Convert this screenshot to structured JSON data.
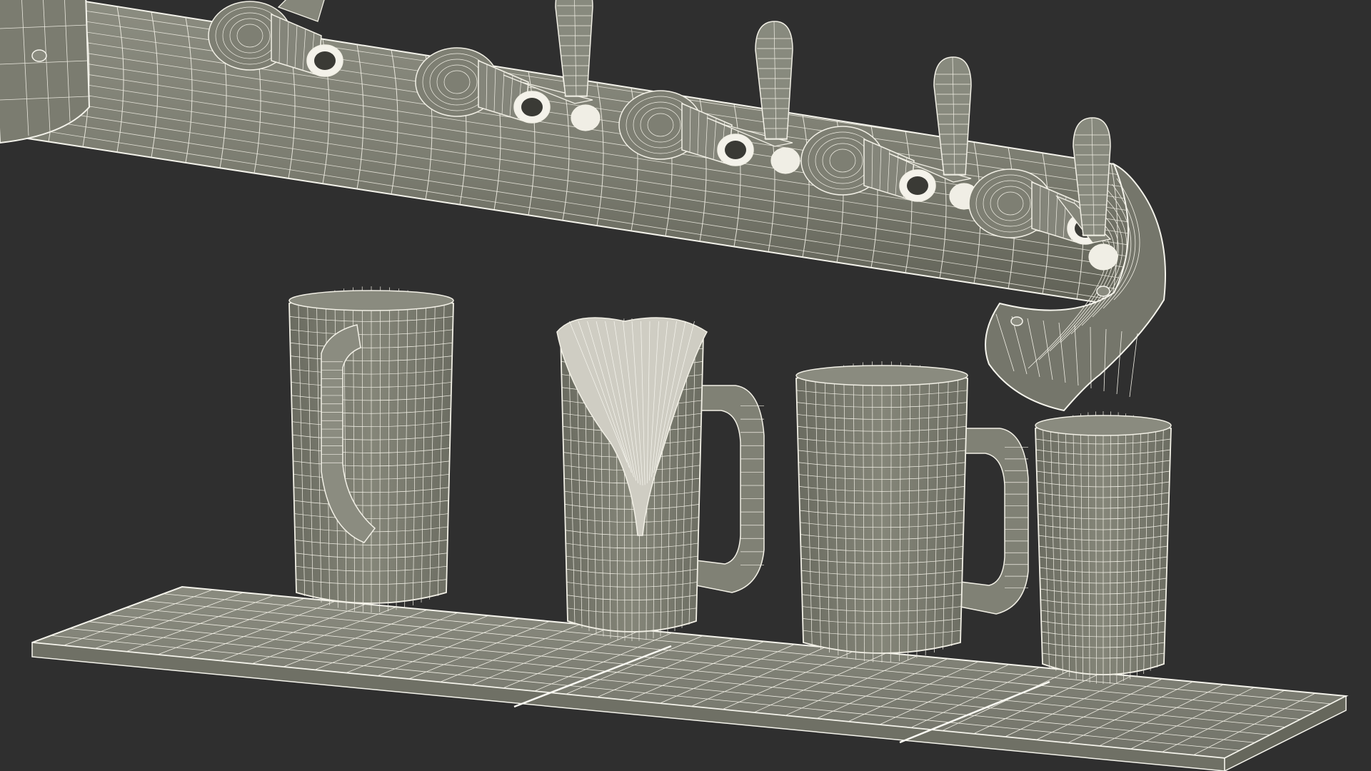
{
  "scene": {
    "subject": "beer-tap-tower-and-mugs-wireframe",
    "colors": {
      "background": "#2f2f2f",
      "surface": "#7d7e72",
      "surface_light": "#8a8b7f",
      "surface_dark": "#66675c",
      "wire": "#f2f0e6"
    },
    "tap_count": 5,
    "mug_count": 4
  }
}
